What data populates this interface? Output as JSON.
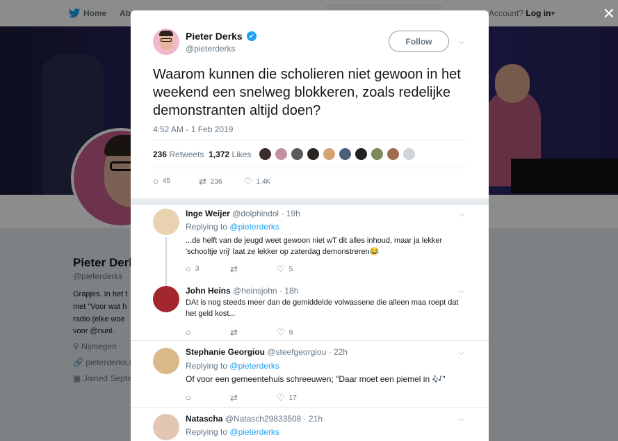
{
  "background": {
    "nav": {
      "home": "Home",
      "about": "Ab",
      "account_prefix": "Account?",
      "login": "Log in",
      "caret": "▾"
    },
    "profile": {
      "name": "Pieter Derk",
      "handle": "@pieterderks",
      "bio_lines": [
        "Grapjes. In het t",
        "met \"Voor wat h",
        "radio (elke woe",
        "voor @nunl."
      ],
      "location": "Nijmegen",
      "website": "pieterderks.n",
      "joined": "Joined Septe"
    }
  },
  "close_glyph": "✕",
  "tweet": {
    "author_name": "Pieter Derks",
    "author_handle": "@pieterderks",
    "verified_glyph": "✔",
    "follow_label": "Follow",
    "text": "Waarom kunnen die scholieren niet gewoon in het weekend een snelweg blokkeren, zoals redelijke demonstranten altijd doen?",
    "timestamp": "4:52 AM - 1 Feb 2019",
    "retweets_count": "236",
    "retweets_label": "Retweets",
    "likes_count": "1,372",
    "likes_label": "Likes",
    "liker_colors": [
      "#3a2e2a",
      "#c48f9f",
      "#5a5a5a",
      "#2b2420",
      "#d4a373",
      "#4a6078",
      "#222222",
      "#7a8b5e",
      "#a06b4f",
      "#cfd6dc"
    ],
    "actions": {
      "replies": "45",
      "retweets": "236",
      "likes": "1.4K"
    }
  },
  "icons": {
    "reply": "○",
    "retweet": "⇄",
    "like": "♡",
    "chevron": "⌵"
  },
  "replies": [
    {
      "name": "Inge Weijer",
      "handle": "@dolphindol",
      "time": "19h",
      "replying_prefix": "Replying to",
      "replying_to": "@pieterderks",
      "text": "...de helft van de jeugd weet gewoon niet wT dit alles inhoud, maar ja lekker 'schooltje vrij' laat ze lekker op zaterdag demonstreren😂",
      "counts": {
        "replies": "3",
        "retweets": "",
        "likes": "5"
      },
      "avatar_color": "#e8d2b0"
    },
    {
      "name": "John Heins",
      "handle": "@heinsjohn",
      "time": "18h",
      "text": "DAt is nog steeds meer dan de gemiddelde volwassene die alleen maa roept dat het geld kost...",
      "counts": {
        "replies": "",
        "retweets": "",
        "likes": "9"
      },
      "avatar_color": "#a3262e"
    },
    {
      "name": "Stephanie Georgiou",
      "handle": "@steefgeorgiou",
      "time": "22h",
      "replying_prefix": "Replying to",
      "replying_to": "@pieterderks",
      "text": "Of voor een gemeentehuis schreeuwen; \"Daar moet een piemel in 🎶\"",
      "counts": {
        "replies": "",
        "retweets": "",
        "likes": "17"
      },
      "avatar_color": "#d9b98a"
    },
    {
      "name": "Natascha",
      "handle": "@Natasch29833508",
      "time": "21h",
      "replying_prefix": "Replying to",
      "replying_to": "@pieterderks",
      "avatar_color": "#e3c7b4"
    }
  ]
}
